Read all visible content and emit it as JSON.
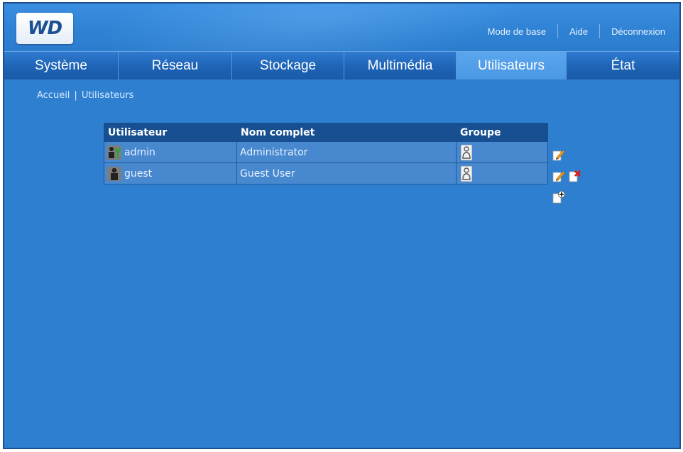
{
  "header": {
    "logo_text": "WD",
    "links": {
      "basic_mode": "Mode de base",
      "help": "Aide",
      "logout": "Déconnexion"
    }
  },
  "nav": {
    "tabs": [
      {
        "label": "Système"
      },
      {
        "label": "Réseau"
      },
      {
        "label": "Stockage"
      },
      {
        "label": "Multimédia"
      },
      {
        "label": "Utilisateurs",
        "active": true
      },
      {
        "label": "État"
      }
    ]
  },
  "breadcrumb": {
    "home": "Accueil",
    "separator": "|",
    "current": "Utilisateurs"
  },
  "users_table": {
    "columns": [
      "Utilisateur",
      "Nom complet",
      "Groupe"
    ],
    "rows": [
      {
        "username": "admin",
        "full_name": "Administrator",
        "icon": "admin-user-icon",
        "group_icon": "group-icon"
      },
      {
        "username": "guest",
        "full_name": "Guest User",
        "icon": "user-icon",
        "group_icon": "group-icon"
      }
    ]
  },
  "actions": {
    "edit_icon": "edit-user-icon",
    "delete_icon": "delete-user-icon",
    "add_icon": "add-user-icon"
  },
  "colors": {
    "background": "#2e7fd0",
    "active_tab": "#4a97e3",
    "table_header": "#174f91",
    "table_row": "#4788cf"
  }
}
